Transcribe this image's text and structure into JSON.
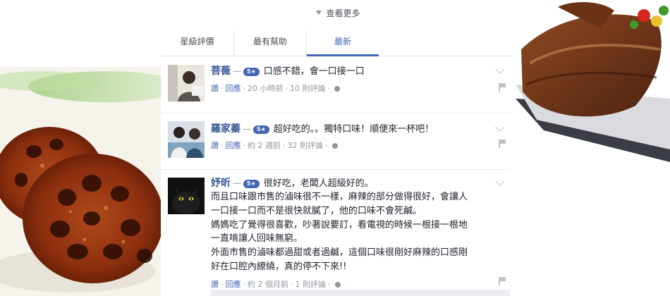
{
  "see_more": "查看更多",
  "tabs": [
    {
      "label": "星級評價",
      "active": false
    },
    {
      "label": "最有幫助",
      "active": false
    },
    {
      "label": "最新",
      "active": true
    }
  ],
  "comments": [
    {
      "author": "菩薇",
      "rating": "5★",
      "text": "口感不錯，會一口接一口",
      "extra_lines": [],
      "actions": {
        "like": "讚",
        "reply": "回應",
        "time": "20 小時前",
        "replies": "10 則評論"
      }
    },
    {
      "author": "羅家蓁",
      "rating": "5★",
      "text": "超好吃的。。獨特口味！順便來一杯吧！",
      "extra_lines": [],
      "actions": {
        "like": "讚",
        "reply": "回應",
        "time": "約 2 週前",
        "replies": "32 則評論"
      }
    },
    {
      "author": "妤昕",
      "rating": "5★",
      "text": "很好吃，老闆人超級好的。",
      "extra_lines": [
        "而且口味跟市售的滷味很不一樣，麻辣的部分做得很好，會讓人",
        "一口接一口而不是很快就膩了，他的口味不會死鹹。",
        "媽媽吃了覺得很喜歡，吵著說要訂，看電視的時候一根接一根地",
        "一直啃讓人回味無窮。",
        "外面市售的滷味都過甜或者過鹹，這個口味很剛好麻辣的口感剛",
        "好在口腔內繚繞，真的停不下來!!"
      ],
      "actions": {
        "like": "讚",
        "reply": "回應",
        "time": "約 2 個月前",
        "replies": "1 則評論"
      }
    }
  ],
  "icons": {
    "see_more": "triangle-down-icon",
    "options": "chevron-down-icon",
    "report": "flag-icon",
    "privacy": "globe-icon"
  },
  "colors": {
    "link": "#4267b2",
    "author": "#385898",
    "meta": "#90949c",
    "text": "#1d2129",
    "badge": "#4267b2",
    "divider": "#dddfe2"
  }
}
